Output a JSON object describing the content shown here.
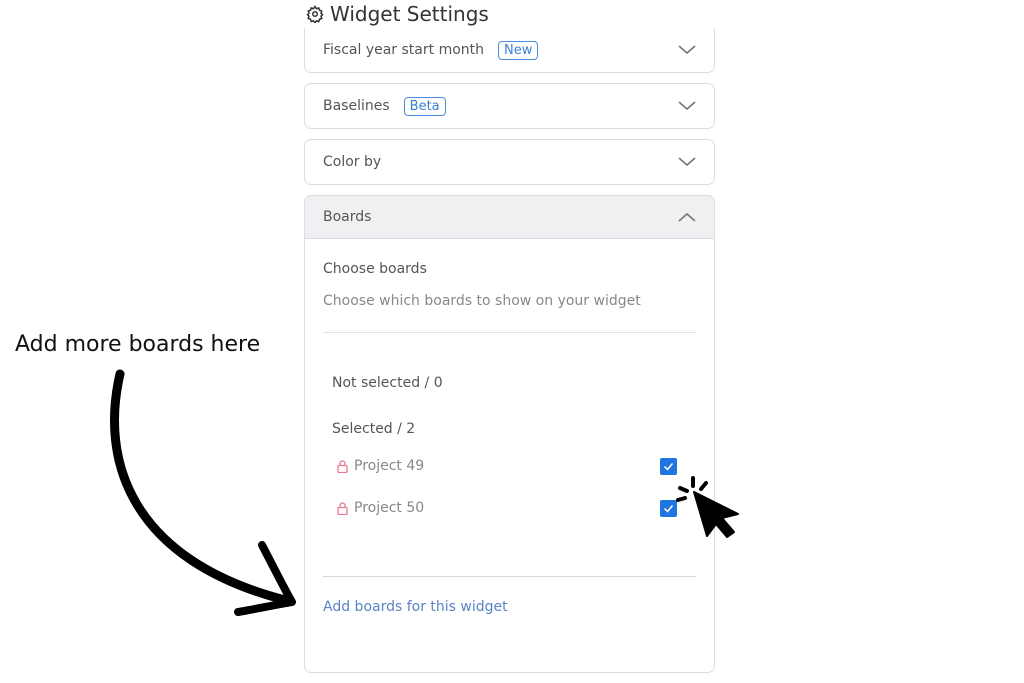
{
  "header": {
    "title": "Widget Settings",
    "icon": "gear-icon"
  },
  "sections": [
    {
      "label": "Fiscal year start month",
      "badge": "New",
      "expanded": false
    },
    {
      "label": "Baselines",
      "badge": "Beta",
      "expanded": false
    },
    {
      "label": "Color by",
      "expanded": false
    },
    {
      "label": "Boards",
      "expanded": true
    }
  ],
  "boards": {
    "choose_title": "Choose boards",
    "choose_desc": "Choose which boards to show on your widget",
    "not_selected": "Not selected / 0",
    "selected": "Selected / 2",
    "items": [
      {
        "name": "Project 49",
        "checked": true
      },
      {
        "name": "Project 50",
        "checked": true
      }
    ],
    "add_link": "Add boards for this widget"
  },
  "annotation": {
    "text": "Add more boards here"
  },
  "colors": {
    "accent": "#1f76e0",
    "badge": "#3a7fd8",
    "lock": "#e87a90",
    "link": "#5a84c4"
  }
}
